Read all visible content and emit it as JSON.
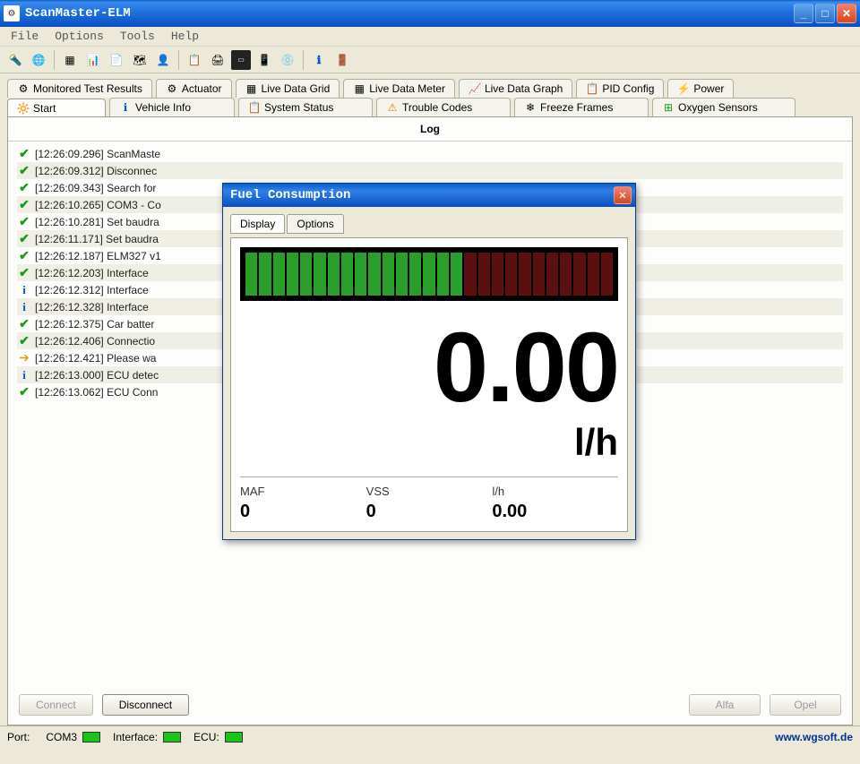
{
  "app": {
    "title": "ScanMaster-ELM"
  },
  "menu": {
    "file": "File",
    "options": "Options",
    "tools": "Tools",
    "help": "Help"
  },
  "tabs_top": [
    {
      "label": "Monitored Test Results"
    },
    {
      "label": "Actuator"
    },
    {
      "label": "Live Data Grid"
    },
    {
      "label": "Live Data Meter"
    },
    {
      "label": "Live Data Graph"
    },
    {
      "label": "PID Config"
    },
    {
      "label": "Power"
    }
  ],
  "tabs_bottom": [
    {
      "label": "Start"
    },
    {
      "label": "Vehicle Info"
    },
    {
      "label": "System Status"
    },
    {
      "label": "Trouble Codes"
    },
    {
      "label": "Freeze Frames"
    },
    {
      "label": "Oxygen Sensors"
    }
  ],
  "log_header": "Log",
  "log": [
    {
      "icon": "check",
      "text": "[12:26:09.296] ScanMaste"
    },
    {
      "icon": "check",
      "text": "[12:26:09.312] Disconnec"
    },
    {
      "icon": "check",
      "text": "[12:26:09.343] Search for"
    },
    {
      "icon": "check",
      "text": "[12:26:10.265] COM3 - Co"
    },
    {
      "icon": "check",
      "text": "[12:26:10.281] Set baudra"
    },
    {
      "icon": "check",
      "text": "[12:26:11.171] Set baudra"
    },
    {
      "icon": "check",
      "text": "[12:26:12.187] ELM327 v1"
    },
    {
      "icon": "check",
      "text": "[12:26:12.203] Interface "
    },
    {
      "icon": "info",
      "text": "[12:26:12.312] Interface "
    },
    {
      "icon": "info",
      "text": "[12:26:12.328] Interface "
    },
    {
      "icon": "check",
      "text": "[12:26:12.375] Car batter"
    },
    {
      "icon": "check",
      "text": "[12:26:12.406] Connectio"
    },
    {
      "icon": "arrow",
      "text": "[12:26:12.421] Please wa"
    },
    {
      "icon": "info",
      "text": "[12:26:13.000] ECU detec"
    },
    {
      "icon": "check",
      "text": "[12:26:13.062] ECU Conn"
    }
  ],
  "buttons": {
    "connect": "Connect",
    "disconnect": "Disconnect",
    "alfa": "Alfa",
    "opel": "Opel"
  },
  "status": {
    "port_label": "Port:",
    "port_value": "COM3",
    "iface_label": "Interface:",
    "ecu_label": "ECU:",
    "url": "www.wgsoft.de"
  },
  "dialog": {
    "title": "Fuel Consumption",
    "tab_display": "Display",
    "tab_options": "Options",
    "value": "0.00",
    "unit": "l/h",
    "sub": {
      "maf_label": "MAF",
      "maf_val": "0",
      "vss_label": "VSS",
      "vss_val": "0",
      "lh_label": "l/h",
      "lh_val": "0.00"
    }
  }
}
